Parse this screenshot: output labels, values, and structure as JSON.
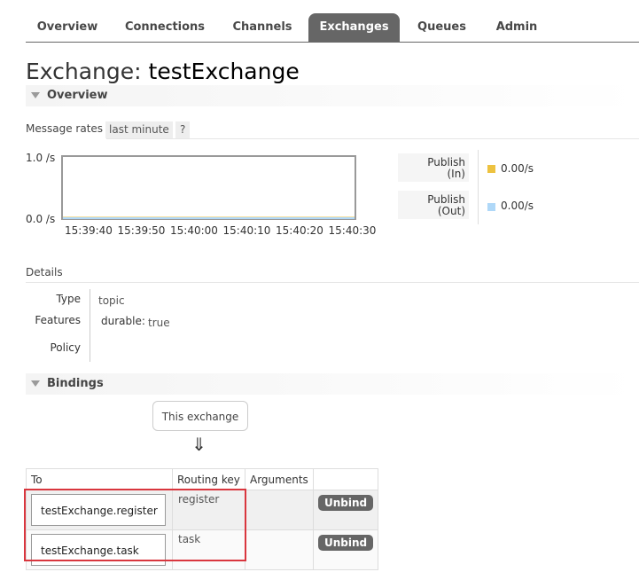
{
  "tabs": [
    "Overview",
    "Connections",
    "Channels",
    "Exchanges",
    "Queues",
    "Admin"
  ],
  "active_tab": "Exchanges",
  "title": {
    "prefix": "Exchange:",
    "name": "testExchange"
  },
  "sections": {
    "overview": "Overview",
    "bindings": "Bindings",
    "details": "Details"
  },
  "message_rates": {
    "label": "Message rates",
    "range": "last minute",
    "help": "?"
  },
  "chart_data": {
    "type": "line",
    "x": [
      "15:39:40",
      "15:39:50",
      "15:40:00",
      "15:40:10",
      "15:40:20",
      "15:40:30"
    ],
    "series": [
      {
        "name": "Publish (In)",
        "values": [
          0,
          0,
          0,
          0,
          0,
          0
        ],
        "color": "#edc240"
      },
      {
        "name": "Publish (Out)",
        "values": [
          0,
          0,
          0,
          0,
          0,
          0
        ],
        "color": "#afd8f8"
      }
    ],
    "y_ticks": [
      "1.0 /s",
      "0.0 /s"
    ],
    "ylim": [
      0,
      1
    ]
  },
  "legend": [
    {
      "line1": "Publish",
      "line2": "(In)",
      "value": "0.00/s",
      "color": "#edc240"
    },
    {
      "line1": "Publish",
      "line2": "(Out)",
      "value": "0.00/s",
      "color": "#afd8f8"
    }
  ],
  "details": {
    "type_label": "Type",
    "type_value": "topic",
    "features_label": "Features",
    "durable_key": "durable:",
    "durable_value": "true",
    "policy_label": "Policy"
  },
  "bindings": {
    "source_label": "This exchange",
    "arrow": "⇓",
    "headers": [
      "To",
      "Routing key",
      "Arguments",
      ""
    ],
    "rows": [
      {
        "to": "testExchange.register",
        "routing_key": "register",
        "arguments": "",
        "action": "Unbind"
      },
      {
        "to": "testExchange.task",
        "routing_key": "task",
        "arguments": "",
        "action": "Unbind"
      }
    ]
  },
  "colors": {
    "tab_active": "#666666",
    "highlight": "#d9363e"
  }
}
